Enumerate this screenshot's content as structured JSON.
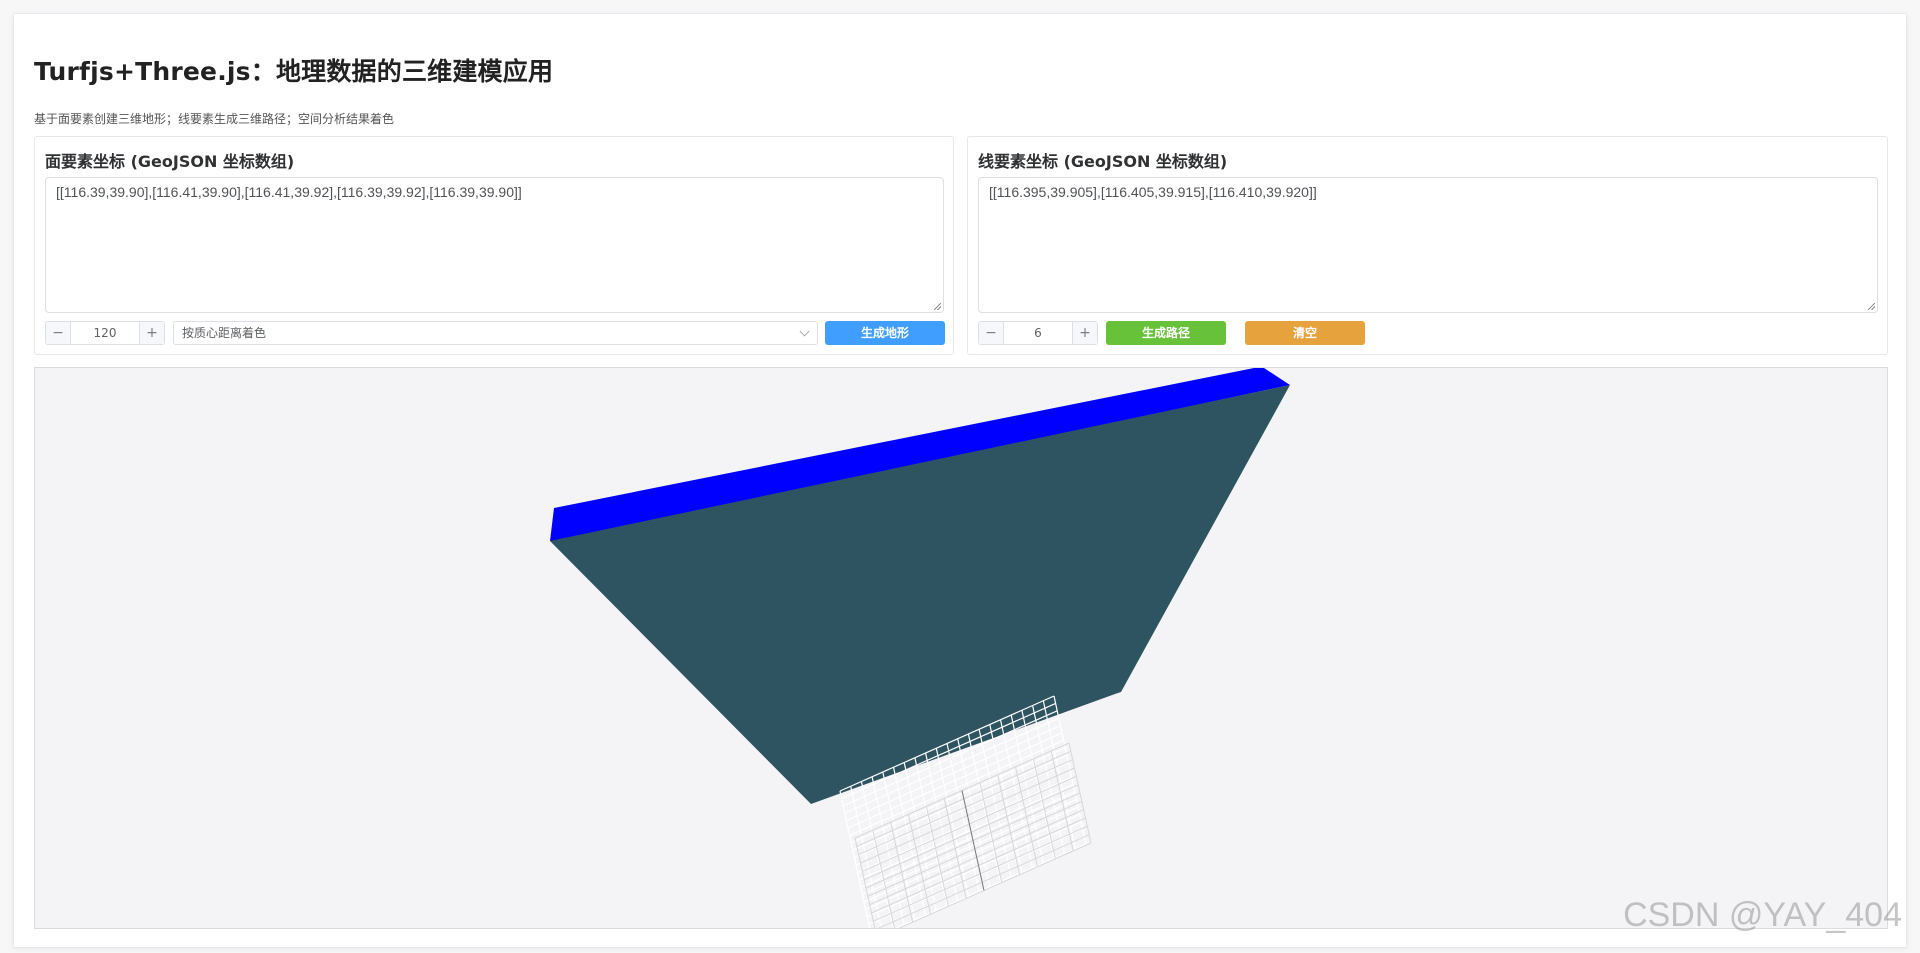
{
  "header": {
    "title": "Turfjs+Three.js：地理数据的三维建模应用",
    "subtitle": "基于面要素创建三维地形；线要素生成三维路径；空间分析结果着色"
  },
  "polygon_panel": {
    "title": "面要素坐标 (GeoJSON 坐标数组)",
    "coordinates": "[[116.39,39.90],[116.41,39.90],[116.41,39.92],[116.39,39.92],[116.39,39.90]]",
    "stepper": {
      "minus": "−",
      "value": "120",
      "plus": "+"
    },
    "color_mode": "按质心距离着色",
    "generate_button": "生成地形"
  },
  "line_panel": {
    "title": "线要素坐标 (GeoJSON 坐标数组)",
    "coordinates": "[[116.395,39.905],[116.405,39.915],[116.410,39.920]]",
    "stepper": {
      "minus": "−",
      "value": "6",
      "plus": "+"
    },
    "generate_button": "生成路径",
    "clear_button": "清空"
  },
  "colors": {
    "primary": "#409eff",
    "success": "#67c23a",
    "warning": "#e6a23c",
    "terrain_top": "#0000ff",
    "terrain_side": "#2e5361",
    "viewport_bg": "#f4f4f7",
    "grid": "#ffffff"
  },
  "watermark": "CSDN @YAY_404"
}
